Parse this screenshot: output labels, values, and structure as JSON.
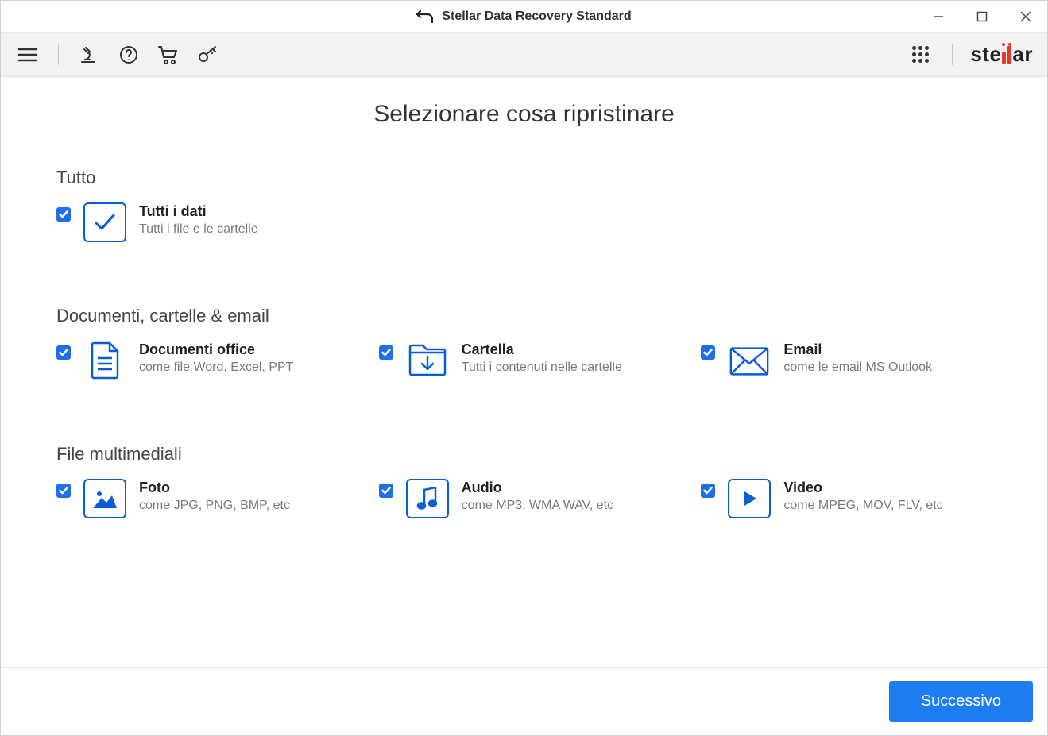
{
  "window": {
    "title": "Stellar Data Recovery Standard"
  },
  "page": {
    "heading": "Selezionare cosa ripristinare"
  },
  "sections": {
    "all": {
      "title": "Tutto",
      "option": {
        "title": "Tutti i dati",
        "desc": "Tutti i file e le cartelle",
        "checked": true
      }
    },
    "docs": {
      "title": "Documenti, cartelle & email",
      "options": [
        {
          "title": "Documenti office",
          "desc": "come file Word, Excel, PPT",
          "checked": true
        },
        {
          "title": "Cartella",
          "desc": "Tutti i contenuti nelle cartelle",
          "checked": true
        },
        {
          "title": "Email",
          "desc": "come le email MS Outlook",
          "checked": true
        }
      ]
    },
    "media": {
      "title": "File multimediali",
      "options": [
        {
          "title": "Foto",
          "desc": "come JPG, PNG, BMP, etc",
          "checked": true
        },
        {
          "title": "Audio",
          "desc": "come MP3, WMA WAV, etc",
          "checked": true
        },
        {
          "title": "Video",
          "desc": "come MPEG, MOV, FLV, etc",
          "checked": true
        }
      ]
    }
  },
  "footer": {
    "next": "Successivo"
  },
  "brand": {
    "pre": "ste",
    "post": "ar"
  }
}
